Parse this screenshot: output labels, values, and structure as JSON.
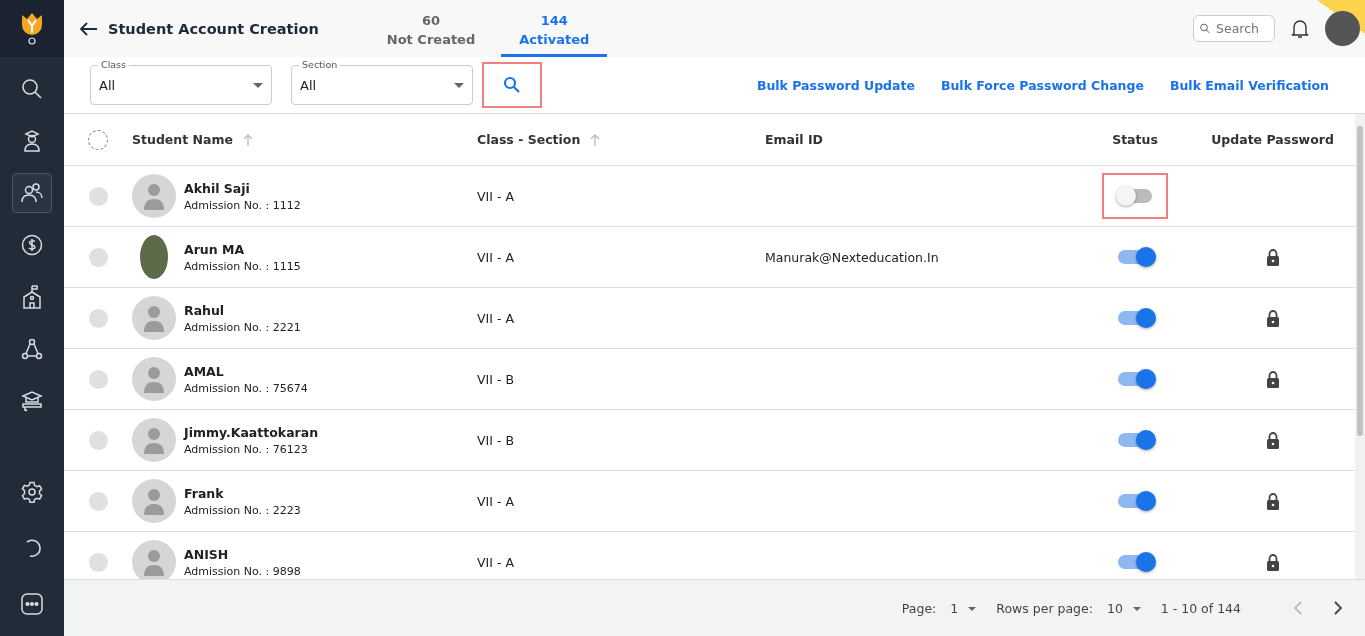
{
  "sidebar": {
    "items": [
      {
        "selected": false
      },
      {
        "selected": false
      },
      {
        "selected": true
      },
      {
        "selected": false
      },
      {
        "selected": false
      },
      {
        "selected": false
      },
      {
        "selected": false
      }
    ],
    "bottom_items": [
      {
        "selected": false
      },
      {
        "selected": false
      },
      {
        "selected": false
      }
    ]
  },
  "header": {
    "title": "Student Account Creation",
    "tabs": [
      {
        "count": "60",
        "label": "Not Created",
        "selected": false
      },
      {
        "count": "144",
        "label": "Activated",
        "selected": true
      }
    ],
    "search": {
      "placeholder": "Search"
    }
  },
  "filters": {
    "fields": [
      {
        "label": "Class",
        "value": "All"
      },
      {
        "label": "Section",
        "value": "All"
      }
    ],
    "search_highlighted": true,
    "actions": [
      "Bulk Password Update",
      "Bulk Force Password Change",
      "Bulk Email Verification"
    ]
  },
  "table": {
    "all_selected": false,
    "columns": [
      {
        "label": "Student Name",
        "sortable": true
      },
      {
        "label": "Class - Section",
        "sortable": true
      },
      {
        "label": "Email ID",
        "sortable": false
      },
      {
        "label": "Status",
        "sortable": false
      },
      {
        "label": "Update Password",
        "sortable": false
      }
    ],
    "rows": [
      {
        "name": "Akhil Saji",
        "admission": "Admission No. : 1112",
        "class_section": "VII - A",
        "email": "",
        "kind": "default",
        "status_on": false,
        "status_highlighted": true,
        "locked": false,
        "selected": false
      },
      {
        "name": "Arun MA",
        "admission": "Admission No. : 1115",
        "class_section": "VII - A",
        "email": "Manurak@Nexteducation.In",
        "kind": "photo",
        "status_on": true,
        "status_highlighted": false,
        "locked": true,
        "selected": false
      },
      {
        "name": "Rahul",
        "admission": "Admission No. : 2221",
        "class_section": "VII - A",
        "email": "",
        "kind": "default",
        "status_on": true,
        "status_highlighted": false,
        "locked": true,
        "selected": false
      },
      {
        "name": "AMAL",
        "admission": "Admission No. : 75674",
        "class_section": "VII - B",
        "email": "",
        "kind": "default",
        "status_on": true,
        "status_highlighted": false,
        "locked": true,
        "selected": false
      },
      {
        "name": "Jimmy.Kaattokaran",
        "admission": "Admission No. : 76123",
        "class_section": "VII - B",
        "email": "",
        "kind": "default",
        "status_on": true,
        "status_highlighted": false,
        "locked": true,
        "selected": false
      },
      {
        "name": "Frank",
        "admission": "Admission No. : 2223",
        "class_section": "VII - A",
        "email": "",
        "kind": "default",
        "status_on": true,
        "status_highlighted": false,
        "locked": true,
        "selected": false
      },
      {
        "name": "ANISH",
        "admission": "Admission No. : 9898",
        "class_section": "VII - A",
        "email": "",
        "kind": "default",
        "status_on": true,
        "status_highlighted": false,
        "locked": true,
        "selected": false
      }
    ]
  },
  "pagination": {
    "page_label": "Page:",
    "page": "1",
    "rows_label": "Rows per page:",
    "rows": "10",
    "range": "1 - 10 of 144"
  }
}
